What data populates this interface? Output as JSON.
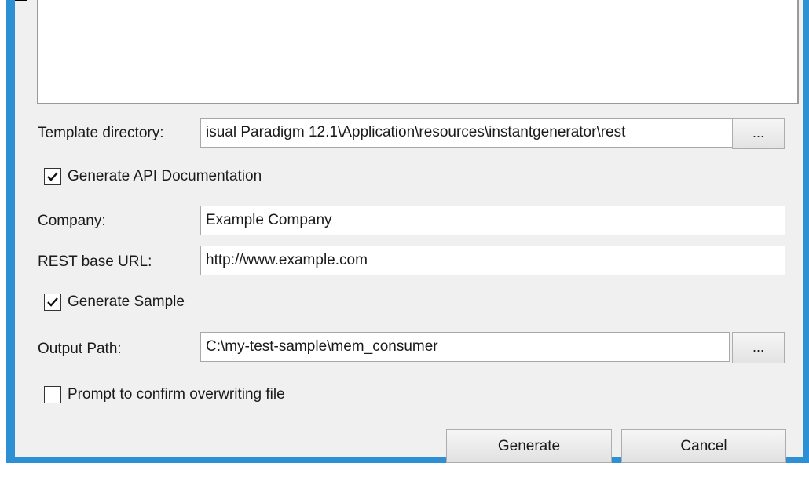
{
  "form": {
    "template_directory": {
      "label": "Template directory:",
      "value": "isual Paradigm 12.1\\Application\\resources\\instantgenerator\\rest",
      "browse_label": "..."
    },
    "generate_api_doc": {
      "label": "Generate API Documentation",
      "checked": true
    },
    "company": {
      "label": "Company:",
      "value": "Example Company"
    },
    "rest_base_url": {
      "label": "REST base URL:",
      "value": "http://www.example.com"
    },
    "generate_sample": {
      "label": "Generate Sample",
      "checked": true
    },
    "output_path": {
      "label": "Output Path:",
      "value": "C:\\my-test-sample\\mem_consumer",
      "browse_label": "..."
    },
    "prompt_overwrite": {
      "label": "Prompt to confirm overwriting file",
      "checked": false
    }
  },
  "buttons": {
    "generate_label": "Generate",
    "cancel_label": "Cancel"
  }
}
